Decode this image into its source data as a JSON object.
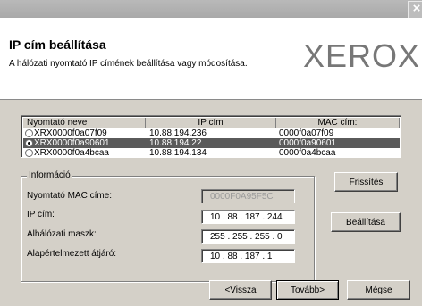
{
  "window": {
    "close_glyph": "×"
  },
  "header": {
    "title": "IP cím beállítása",
    "subtitle": "A hálózati nyomtató IP címének beállítása vagy módosítása.",
    "logo": "XEROX"
  },
  "printer_table": {
    "columns": [
      "Nyomtató neve",
      "IP cím",
      "MAC cím:"
    ],
    "rows": [
      {
        "name": "XRX0000f0a07f09",
        "ip": "10.88.194.236",
        "mac": "0000f0a07f09",
        "selected": false
      },
      {
        "name": "XRX0000f0a90601",
        "ip": "10.88.194.22",
        "mac": "0000f0a90601",
        "selected": true
      },
      {
        "name": "XRX0000f0a4bcaa",
        "ip": "10.88.194.134",
        "mac": "0000f0a4bcaa",
        "selected": false
      }
    ]
  },
  "info": {
    "legend": "Információ",
    "mac_label": "Nyomtató MAC címe:",
    "mac_value": "0000F0A95F5C",
    "ip_label": "IP cím:",
    "ip_value": "10 . 88 . 187 . 244",
    "mask_label": "Alhálózati maszk:",
    "mask_value": "255 . 255 . 255 . 0",
    "gateway_label": "Alapértelmezett átjáró:",
    "gateway_value": "10 . 88 . 187 . 1"
  },
  "buttons": {
    "refresh": "Frissítés",
    "configure": "Beállítása",
    "back": "<Vissza",
    "next": "Tovább>",
    "cancel": "Mégse"
  }
}
